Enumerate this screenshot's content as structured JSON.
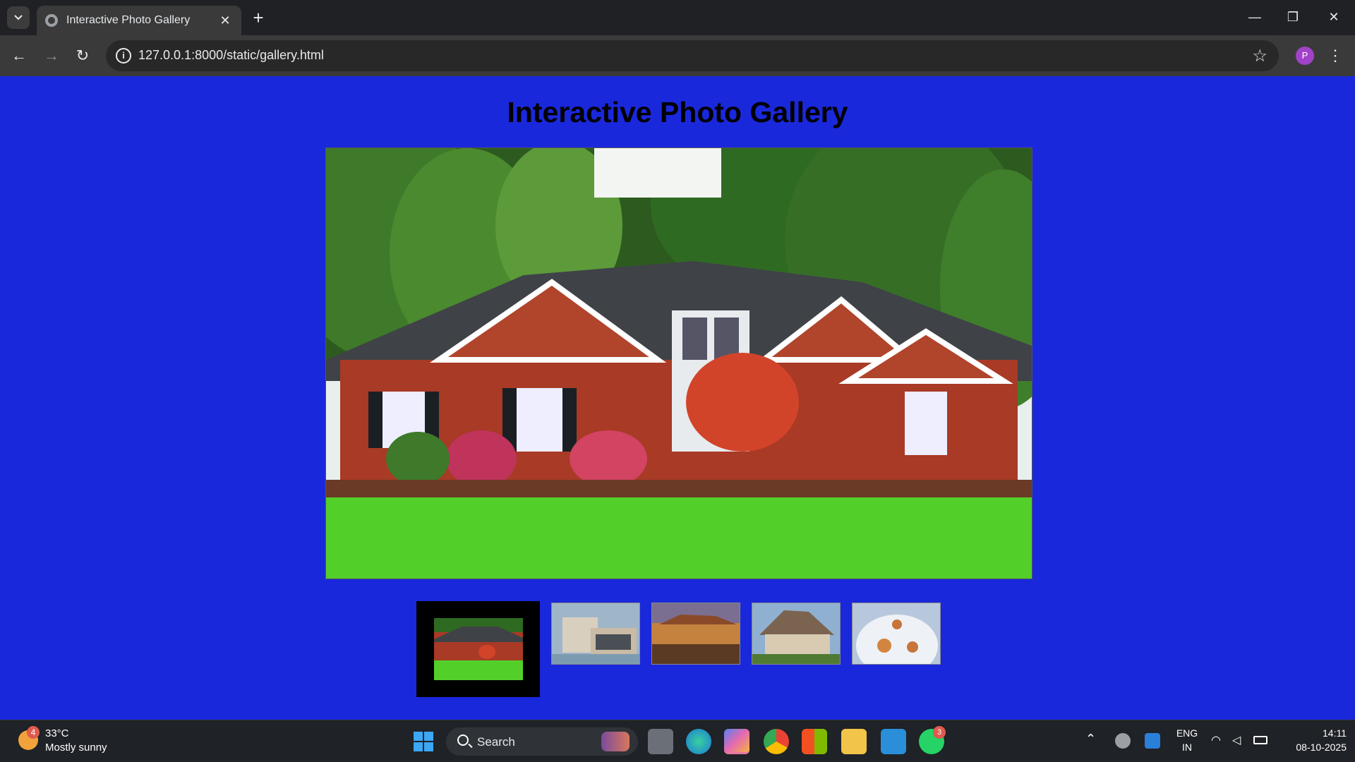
{
  "browser": {
    "tab_title": "Interactive Photo Gallery",
    "url": "127.0.0.1:8000/static/gallery.html",
    "profile_initial": "P"
  },
  "page": {
    "title": "Interactive Photo Gallery",
    "main_photo": "red-brick-house",
    "thumbnails": [
      {
        "name": "red-brick-house",
        "active": true
      },
      {
        "name": "modern-villa",
        "active": false
      },
      {
        "name": "lakeside-mansion",
        "active": false
      },
      {
        "name": "thatched-cottage",
        "active": false
      },
      {
        "name": "snow-dome-house",
        "active": false
      }
    ],
    "background_color": "#1a28dc"
  },
  "taskbar": {
    "weather_temp": "33°C",
    "weather_desc": "Mostly sunny",
    "weather_badge": "4",
    "search_label": "Search",
    "whatsapp_badge": "3",
    "lang_top": "ENG",
    "lang_bottom": "IN",
    "time": "14:11",
    "date": "08-10-2025"
  }
}
